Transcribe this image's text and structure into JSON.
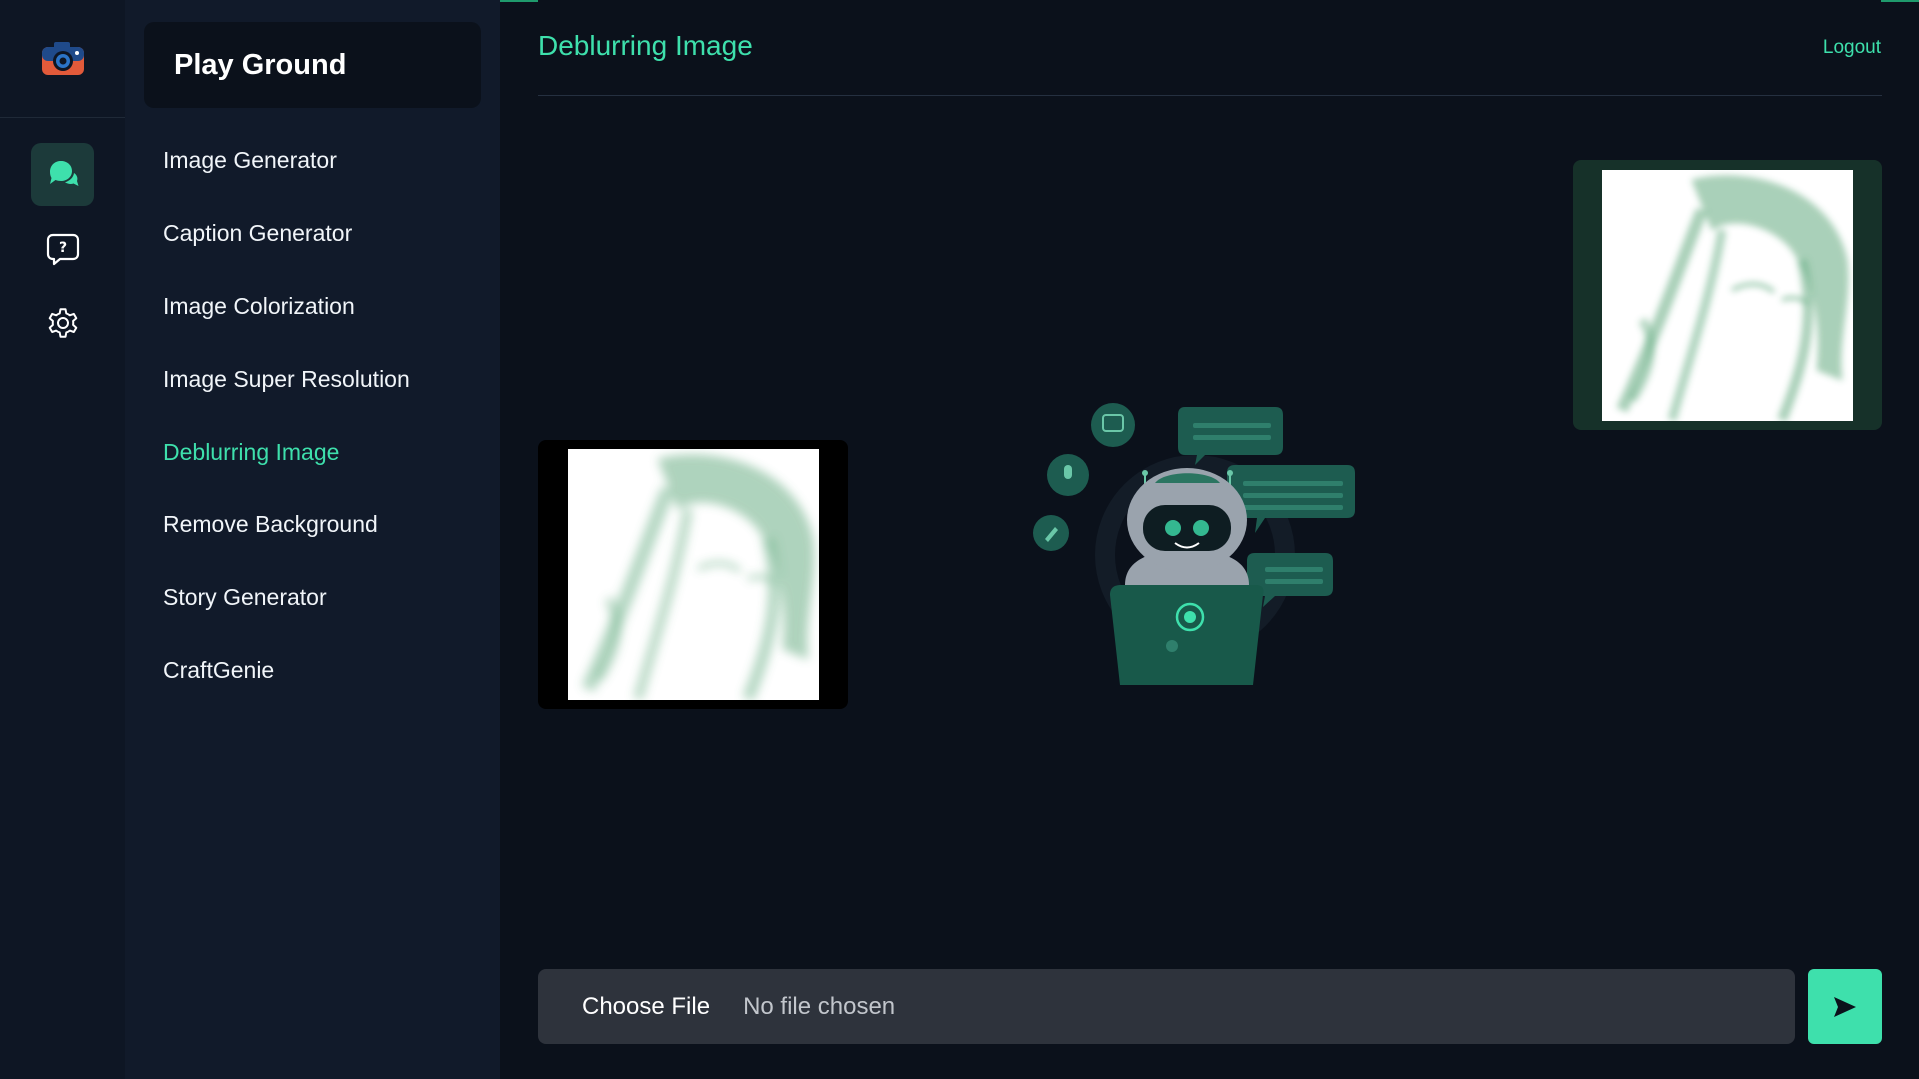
{
  "app": {
    "accent": "#3ee0ac",
    "background": "#0b111b"
  },
  "rail": {
    "logo_icon": "camera-logo-icon",
    "items": [
      {
        "icon": "chat-bubbles-icon",
        "active": true
      },
      {
        "icon": "help-question-icon",
        "active": false
      },
      {
        "icon": "gear-icon",
        "active": false
      }
    ]
  },
  "sidebar": {
    "title": "Play Ground",
    "items": [
      {
        "label": "Image Generator"
      },
      {
        "label": "Caption Generator"
      },
      {
        "label": "Image Colorization"
      },
      {
        "label": "Image Super Resolution"
      },
      {
        "label": "Deblurring Image",
        "active": true
      },
      {
        "label": "Remove Background"
      },
      {
        "label": "Story Generator"
      },
      {
        "label": "CraftGenie"
      }
    ]
  },
  "header": {
    "title": "Deblurring Image",
    "logout_label": "Logout"
  },
  "upload": {
    "choose_label": "Choose File",
    "status": "No file chosen",
    "send_icon": "send-arrow-icon"
  }
}
